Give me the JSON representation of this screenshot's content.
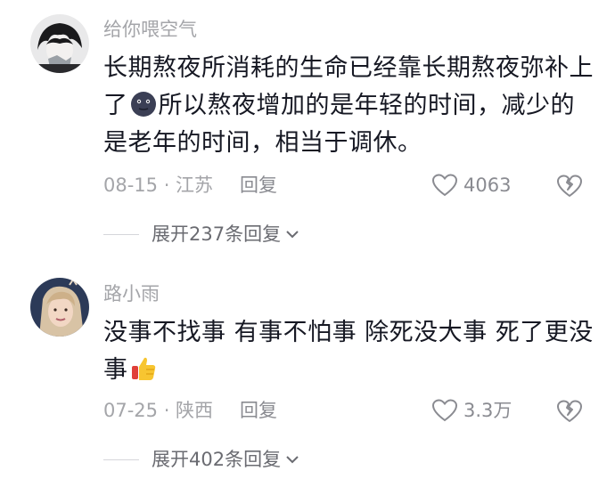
{
  "comments": [
    {
      "author": "给你喂空气",
      "text_part1": "长期熬夜所消耗的生命已经靠长期熬夜弥补上了",
      "text_part2": "所以熬夜增加的是年轻的时间，减少的是老年的时间，相当于调休。",
      "emoji": "moon-face-emoji",
      "date": "08-15 · 江苏",
      "reply_label": "回复",
      "likes": "4063",
      "expand_label": "展开237条回复"
    },
    {
      "author": "路小雨",
      "text_part1": "没事不找事 有事不怕事 除死没大事 死了更没事",
      "emoji": "thumbs-up-emoji",
      "date": "07-25 · 陕西",
      "reply_label": "回复",
      "likes": "3.3万",
      "expand_label": "展开402条回复"
    }
  ],
  "colors": {
    "text": "#161823",
    "secondary": "#a4a5a9",
    "expand": "#6a6b71"
  }
}
